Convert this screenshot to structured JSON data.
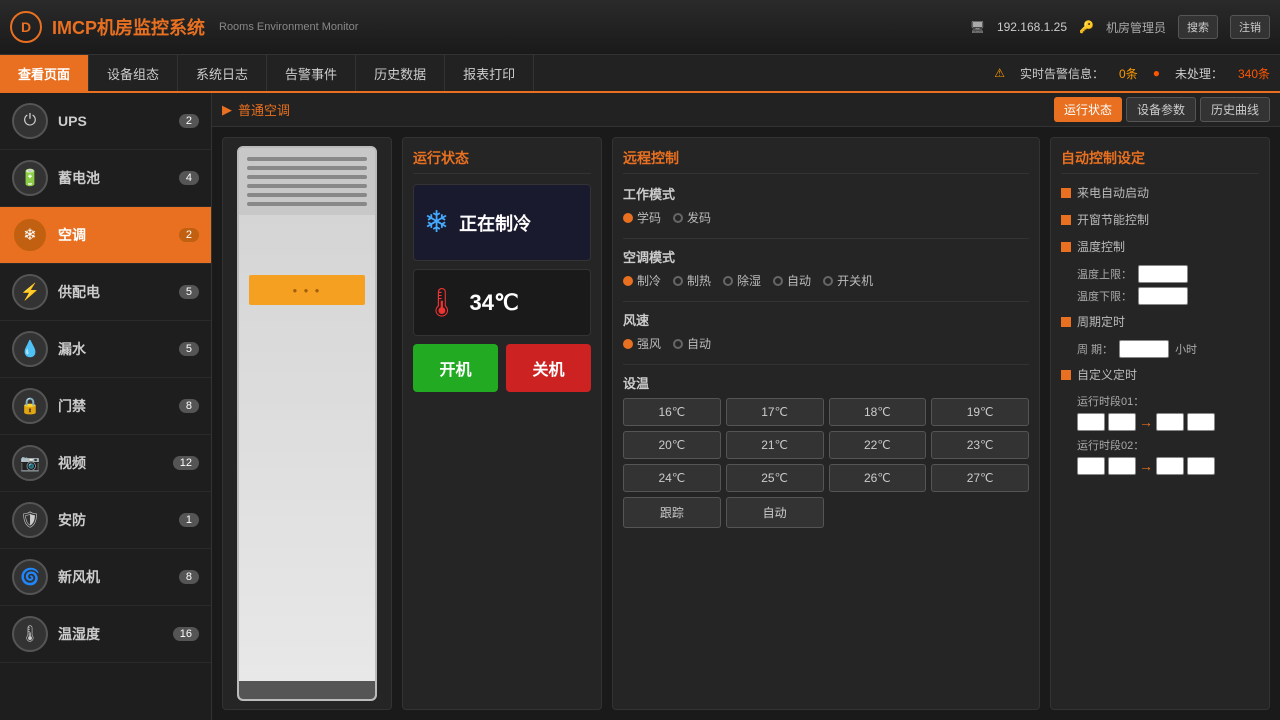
{
  "header": {
    "logo_text": "D",
    "title": "IMCP机房监控系统",
    "subtitle": "Rooms Environment Monitor",
    "ip": "192.168.1.25",
    "manager_label": "机房管理员",
    "search_label": "搜索",
    "logout_label": "注销"
  },
  "navbar": {
    "items": [
      {
        "label": "查看页面",
        "active": true
      },
      {
        "label": "设备组态",
        "active": false
      },
      {
        "label": "系统日志",
        "active": false
      },
      {
        "label": "告警事件",
        "active": false
      },
      {
        "label": "历史数据",
        "active": false
      },
      {
        "label": "报表打印",
        "active": false
      }
    ],
    "alerts": {
      "realtime_label": "实时告警信息：",
      "alert_count": "0条",
      "unhandled_label": "未处理：",
      "unhandled_count": "340条"
    }
  },
  "sidebar": {
    "items": [
      {
        "label": "UPS",
        "badge": "2",
        "icon": "⏻",
        "active": false
      },
      {
        "label": "蓄电池",
        "badge": "4",
        "icon": "🔋",
        "active": false
      },
      {
        "label": "空调",
        "badge": "2",
        "icon": "❄",
        "active": true
      },
      {
        "label": "供配电",
        "badge": "5",
        "icon": "⚡",
        "active": false
      },
      {
        "label": "漏水",
        "badge": "5",
        "icon": "💧",
        "active": false
      },
      {
        "label": "门禁",
        "badge": "8",
        "icon": "🔒",
        "active": false
      },
      {
        "label": "视频",
        "badge": "12",
        "icon": "📷",
        "active": false
      },
      {
        "label": "安防",
        "badge": "1",
        "icon": "🛡",
        "active": false
      },
      {
        "label": "新风机",
        "badge": "8",
        "icon": "🌀",
        "active": false
      },
      {
        "label": "温湿度",
        "badge": "16",
        "icon": "🌡",
        "active": false
      }
    ]
  },
  "content": {
    "breadcrumb": "普通空调",
    "toolbar_buttons": [
      {
        "label": "运行状态",
        "active": true
      },
      {
        "label": "设备参数",
        "active": false
      },
      {
        "label": "历史曲线",
        "active": false
      }
    ],
    "status_panel": {
      "title": "运行状态",
      "cooling_status": "正在制冷",
      "temperature": "34℃",
      "btn_on": "开机",
      "btn_off": "关机"
    },
    "remote_panel": {
      "title": "远程控制",
      "work_mode": {
        "label": "工作模式",
        "options": [
          "学码",
          "发码"
        ]
      },
      "ac_mode": {
        "label": "空调模式",
        "options": [
          "制冷",
          "制热",
          "除湿",
          "自动",
          "开关机"
        ]
      },
      "fan": {
        "label": "风速",
        "options": [
          "强风",
          "自动"
        ]
      },
      "temp_label": "设温",
      "temp_buttons": [
        "16℃",
        "17℃",
        "18℃",
        "19℃",
        "20℃",
        "21℃",
        "22℃",
        "23℃",
        "24℃",
        "25℃",
        "26℃",
        "27℃",
        "跟踪",
        "自动"
      ]
    },
    "auto_panel": {
      "title": "自动控制设定",
      "options": [
        {
          "label": "来电自动启动"
        },
        {
          "label": "开窗节能控制"
        },
        {
          "label": "温度控制"
        },
        {
          "label": "周期定时"
        },
        {
          "label": "自定义定时"
        }
      ],
      "temp_upper_label": "温度上限：",
      "temp_lower_label": "温度下限：",
      "cycle_label": "周  期：",
      "hour_label": "小时",
      "time01_label": "运行时段01：",
      "time02_label": "运行时段02："
    }
  }
}
